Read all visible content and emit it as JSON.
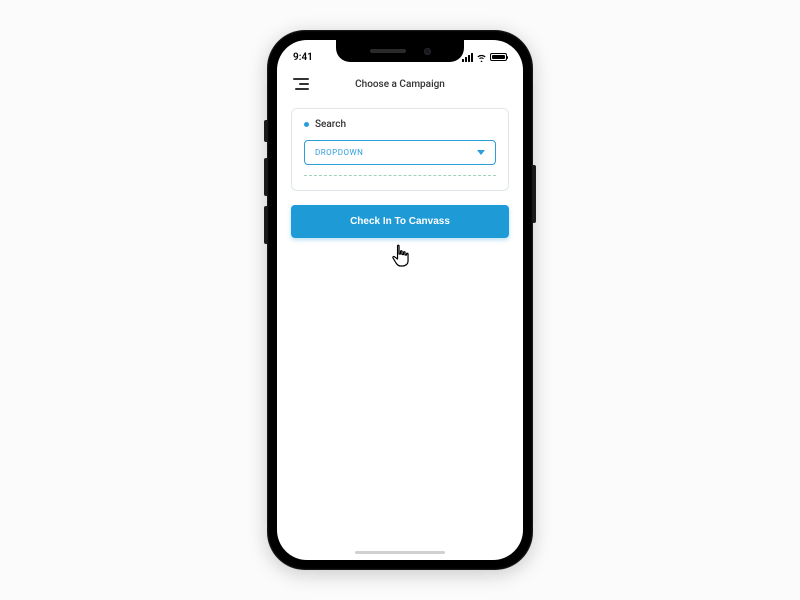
{
  "status": {
    "time": "9:41"
  },
  "header": {
    "title": "Choose a Campaign"
  },
  "search": {
    "label": "Search",
    "dropdown_text": "Dropdown"
  },
  "actions": {
    "check_in": "Check In To Canvass"
  }
}
